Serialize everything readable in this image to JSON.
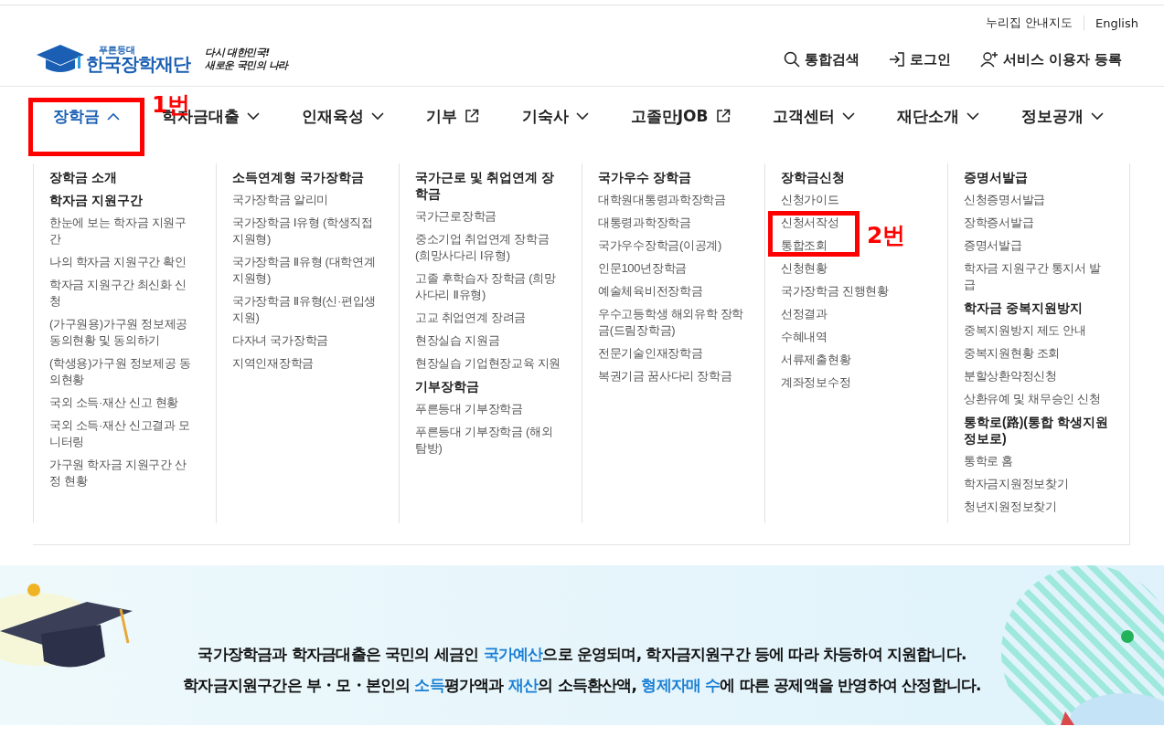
{
  "utility_links": [
    "누리집 안내지도",
    "English"
  ],
  "logo": {
    "tagline": "푸른등대",
    "name": "한국장학재단",
    "slogan": [
      "다시 대한민국!",
      "새로운 국민의 나라"
    ]
  },
  "header_actions": [
    "통합검색",
    "로그인",
    "서비스 이용자 등록"
  ],
  "nav": [
    {
      "label": "장학금",
      "kind": "dropdown",
      "selected": true
    },
    {
      "label": "학자금대출",
      "kind": "dropdown",
      "selected": false
    },
    {
      "label": "인재육성",
      "kind": "dropdown",
      "selected": false
    },
    {
      "label": "기부",
      "kind": "external",
      "selected": false
    },
    {
      "label": "기숙사",
      "kind": "dropdown",
      "selected": false
    },
    {
      "label": "고졸만JOB",
      "kind": "external",
      "selected": false
    },
    {
      "label": "고객센터",
      "kind": "dropdown",
      "selected": false
    },
    {
      "label": "재단소개",
      "kind": "dropdown",
      "selected": false
    },
    {
      "label": "정보공개",
      "kind": "dropdown",
      "selected": false
    }
  ],
  "mega_menu": [
    [
      {
        "kind": "heading",
        "text": "장학금 소개"
      },
      {
        "kind": "heading",
        "text": "학자금 지원구간"
      },
      {
        "kind": "link",
        "text": "한눈에 보는 학자금 지원구간"
      },
      {
        "kind": "link",
        "text": "나의 학자금 지원구간 확인"
      },
      {
        "kind": "link",
        "text": "학자금 지원구간 최신화 신청"
      },
      {
        "kind": "link",
        "text": "(가구원용)가구원 정보제공 동의현황 및 동의하기"
      },
      {
        "kind": "link",
        "text": "(학생용)가구원 정보제공 동의현황"
      },
      {
        "kind": "link",
        "text": "국외 소득·재산 신고 현황"
      },
      {
        "kind": "link",
        "text": "국외 소득·재산 신고결과 모니터링"
      },
      {
        "kind": "link",
        "text": "가구원 학자금 지원구간 산정 현황"
      }
    ],
    [
      {
        "kind": "heading",
        "text": "소득연계형 국가장학금"
      },
      {
        "kind": "link",
        "text": "국가장학금 알리미"
      },
      {
        "kind": "link",
        "text": "국가장학금 Ⅰ유형 (학생직접지원형)"
      },
      {
        "kind": "link",
        "text": "국가장학금 Ⅱ유형 (대학연계지원형)"
      },
      {
        "kind": "link",
        "text": "국가장학금 Ⅱ유형(신·편입생지원)"
      },
      {
        "kind": "link",
        "text": "다자녀 국가장학금"
      },
      {
        "kind": "link",
        "text": "지역인재장학금"
      }
    ],
    [
      {
        "kind": "heading",
        "text": "국가근로 및 취업연계 장학금"
      },
      {
        "kind": "link",
        "text": "국가근로장학금"
      },
      {
        "kind": "link",
        "text": "중소기업 취업연계 장학금 (희망사다리 Ⅰ유형)"
      },
      {
        "kind": "link",
        "text": "고졸 후학습자 장학금 (희망사다리 Ⅱ유형)"
      },
      {
        "kind": "link",
        "text": "고교 취업연계 장려금"
      },
      {
        "kind": "link",
        "text": "현장실습 지원금"
      },
      {
        "kind": "link",
        "text": "현장실습 기업현장교육 지원"
      },
      {
        "kind": "heading",
        "text": "기부장학금"
      },
      {
        "kind": "link",
        "text": "푸른등대 기부장학금"
      },
      {
        "kind": "link",
        "text": "푸른등대 기부장학금 (해외탐방)"
      }
    ],
    [
      {
        "kind": "heading",
        "text": "국가우수 장학금"
      },
      {
        "kind": "link",
        "text": "대학원대통령과학장학금"
      },
      {
        "kind": "link",
        "text": "대통령과학장학금"
      },
      {
        "kind": "link",
        "text": "국가우수장학금(이공계)"
      },
      {
        "kind": "link",
        "text": "인문100년장학금"
      },
      {
        "kind": "link",
        "text": "예술체육비전장학금"
      },
      {
        "kind": "link",
        "text": "우수고등학생 해외유학 장학금(드림장학금)"
      },
      {
        "kind": "link",
        "text": "전문기술인재장학금"
      },
      {
        "kind": "link",
        "text": "복권기금 꿈사다리 장학금"
      }
    ],
    [
      {
        "kind": "heading",
        "text": "장학금신청"
      },
      {
        "kind": "link",
        "text": "신청가이드"
      },
      {
        "kind": "link",
        "text": "신청서작성"
      },
      {
        "kind": "link",
        "text": "통합조회"
      },
      {
        "kind": "link",
        "text": "신청현황"
      },
      {
        "kind": "link",
        "text": "국가장학금 진행현황"
      },
      {
        "kind": "link",
        "text": "선정결과"
      },
      {
        "kind": "link",
        "text": "수혜내역"
      },
      {
        "kind": "link",
        "text": "서류제출현황"
      },
      {
        "kind": "link",
        "text": "계좌정보수정"
      }
    ],
    [
      {
        "kind": "heading",
        "text": "증명서발급"
      },
      {
        "kind": "link",
        "text": "신청증명서발급"
      },
      {
        "kind": "link",
        "text": "장학증서발급"
      },
      {
        "kind": "link",
        "text": "증명서발급"
      },
      {
        "kind": "link",
        "text": "학자금 지원구간 통지서 발급"
      },
      {
        "kind": "heading",
        "text": "학자금 중복지원방지"
      },
      {
        "kind": "link",
        "text": "중복지원방지 제도 안내"
      },
      {
        "kind": "link",
        "text": "중복지원현황 조회"
      },
      {
        "kind": "link",
        "text": "분할상환약정신청"
      },
      {
        "kind": "link",
        "text": "상환유예 및 채무승인 신청"
      },
      {
        "kind": "heading",
        "text": "통학로(路)(통합 학생지원 정보로)"
      },
      {
        "kind": "link",
        "text": "통학로 홈"
      },
      {
        "kind": "link",
        "text": "학자금지원정보찾기"
      },
      {
        "kind": "link",
        "text": "청년지원정보찾기"
      }
    ]
  ],
  "annotations": [
    "1번",
    "2번"
  ],
  "banner": [
    [
      {
        "text": "국가장학금과 학자금대출은 국민의 세금인 ",
        "highlight": false
      },
      {
        "text": "국가예산",
        "highlight": true
      },
      {
        "text": "으로 운영되며, 학자금지원구간 등에 따라 차등하여 지원합니다.",
        "highlight": false
      }
    ],
    [
      {
        "text": "학자금지원구간은 부・모・본인의 ",
        "highlight": false
      },
      {
        "text": "소득",
        "highlight": true
      },
      {
        "text": "평가액과 ",
        "highlight": false
      },
      {
        "text": "재산",
        "highlight": true
      },
      {
        "text": "의 소득환산액, ",
        "highlight": false
      },
      {
        "text": "형제자매 수",
        "highlight": true
      },
      {
        "text": "에 따른 공제액을 반영하여 산정합니다.",
        "highlight": false
      }
    ]
  ]
}
